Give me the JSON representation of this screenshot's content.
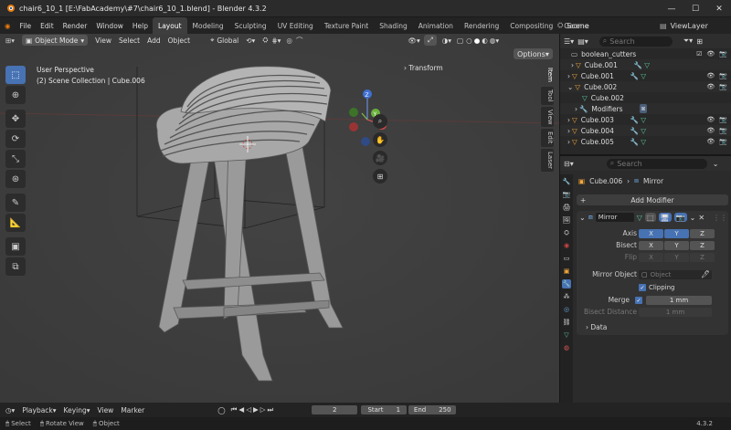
{
  "window": {
    "title": "chair6_10_1 [E:\\FabAcademy\\#7\\chair6_10_1.blend] - Blender 4.3.2",
    "controls": [
      "—",
      "☐",
      "✕"
    ]
  },
  "menu": {
    "items": [
      "File",
      "Edit",
      "Render",
      "Window",
      "Help"
    ],
    "workspaces": [
      "Layout",
      "Modeling",
      "Sculpting",
      "UV Editing",
      "Texture Paint",
      "Shading",
      "Animation",
      "Rendering",
      "Compositing",
      "Geome"
    ],
    "active_workspace": "Layout",
    "scene": "Scene",
    "view_layer": "ViewLayer"
  },
  "viewport_header": {
    "mode": "Object Mode",
    "menus": [
      "View",
      "Select",
      "Add",
      "Object"
    ],
    "transform_orientation": "Global",
    "options_label": "Options"
  },
  "viewport": {
    "perspective_label": "User Perspective",
    "collection_label": "(2) Scene Collection | Cube.006",
    "transform_label": "Transform",
    "gizmo_axes": [
      "X",
      "Y",
      "Z"
    ],
    "npanel_tabs": [
      "Item",
      "Tool",
      "View",
      "Edit",
      "Laser"
    ]
  },
  "outliner": {
    "search_placeholder": "Search",
    "rows": [
      {
        "name": "boolean_cutters",
        "type": "collection"
      },
      {
        "name": "Cube.001",
        "type": "mesh"
      },
      {
        "name": "Cube.001",
        "type": "mesh"
      },
      {
        "name": "Cube.002",
        "type": "mesh"
      },
      {
        "name": "Cube.002",
        "type": "data"
      },
      {
        "name": "Modifiers",
        "type": "modifiers"
      },
      {
        "name": "Cube.003",
        "type": "mesh"
      },
      {
        "name": "Cube.004",
        "type": "mesh"
      },
      {
        "name": "Cube.005",
        "type": "mesh"
      }
    ]
  },
  "properties": {
    "search_placeholder": "Search",
    "breadcrumb_object": "Cube.006",
    "breadcrumb_modifier": "Mirror",
    "add_modifier_label": "Add Modifier",
    "modifier_name": "Mirror",
    "axis_label": "Axis",
    "bisect_label": "Bisect",
    "flip_label": "Flip",
    "axes": [
      "X",
      "Y",
      "Z"
    ],
    "mirror_object_label": "Mirror Object",
    "mirror_object_placeholder": "Object",
    "clipping_label": "Clipping",
    "merge_label": "Merge",
    "merge_value": "1 mm",
    "bisect_distance_label": "Bisect Distance",
    "bisect_distance_value": "1 mm",
    "data_label": "Data"
  },
  "timeline": {
    "menus": [
      "Playback",
      "Keying",
      "View",
      "Marker"
    ],
    "current_frame": "2",
    "start_label": "Start",
    "start_value": "1",
    "end_label": "End",
    "end_value": "250"
  },
  "statusbar": {
    "items": [
      "Select",
      "Rotate View",
      "Object"
    ],
    "version": "4.3.2"
  },
  "colors": {
    "accent": "#4772b3",
    "viewport_bg": "#3d3d3d",
    "panel_bg": "#2b2b2b",
    "mesh_icon": "#f5a83a",
    "modifier_icon": "#6aa3d9",
    "data_icon": "#5bc89c"
  }
}
